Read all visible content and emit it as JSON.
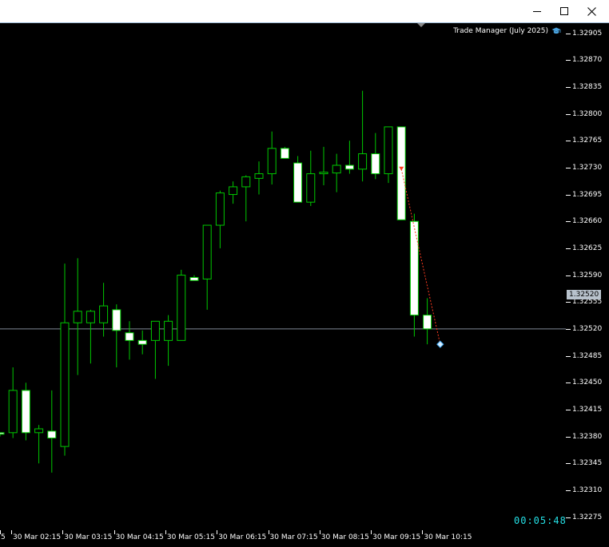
{
  "window": {
    "controls": [
      "minimize-icon",
      "maximize-icon",
      "close-icon"
    ]
  },
  "indicator": {
    "label": "Trade Manager (July 2025)",
    "icon": "graduation-cap-icon"
  },
  "countdown": "00:05:48",
  "colors": {
    "background": "#000000",
    "bull_body": "#000000",
    "bear_body": "#ffffff",
    "wick": "#00c800",
    "bid_line": "#7f8a95",
    "countdown": "#25e0e6",
    "trade_line": "#ff3b1f"
  },
  "chart_data": {
    "type": "candlestick",
    "price_axis": {
      "range": [
        1.32258,
        1.32918
      ],
      "ticks": [
        "1.32905",
        "1.32870",
        "1.32835",
        "1.32800",
        "1.32765",
        "1.32730",
        "1.32695",
        "1.32660",
        "1.32625",
        "1.32590",
        "1.32555",
        "1.32520",
        "1.32485",
        "1.32450",
        "1.32415",
        "1.32380",
        "1.32345",
        "1.32310",
        "1.32275"
      ],
      "current_price": "1.32520"
    },
    "time_axis": {
      "labels": [
        "5",
        "30 Mar 02:15",
        "30 Mar 03:15",
        "30 Mar 04:15",
        "30 Mar 05:15",
        "30 Mar 06:15",
        "30 Mar 07:15",
        "30 Mar 08:15",
        "30 Mar 09:15",
        "30 Mar 10:15"
      ]
    },
    "candles": [
      {
        "o": 1.32385,
        "h": 1.32385,
        "l": 1.3238,
        "c": 1.32383
      },
      {
        "o": 1.32385,
        "h": 1.3247,
        "l": 1.32378,
        "c": 1.3244
      },
      {
        "o": 1.3244,
        "h": 1.3245,
        "l": 1.32375,
        "c": 1.32385
      },
      {
        "o": 1.32385,
        "h": 1.32395,
        "l": 1.32345,
        "c": 1.3239
      },
      {
        "o": 1.32387,
        "h": 1.3244,
        "l": 1.32333,
        "c": 1.32378
      },
      {
        "o": 1.32367,
        "h": 1.32605,
        "l": 1.32355,
        "c": 1.32528
      },
      {
        "o": 1.32528,
        "h": 1.32612,
        "l": 1.3246,
        "c": 1.32543
      },
      {
        "o": 1.32528,
        "h": 1.32545,
        "l": 1.32475,
        "c": 1.32543
      },
      {
        "o": 1.32528,
        "h": 1.3258,
        "l": 1.3251,
        "c": 1.3255
      },
      {
        "o": 1.32545,
        "h": 1.32552,
        "l": 1.3247,
        "c": 1.32518
      },
      {
        "o": 1.32515,
        "h": 1.3253,
        "l": 1.3248,
        "c": 1.32505
      },
      {
        "o": 1.32505,
        "h": 1.32518,
        "l": 1.32487,
        "c": 1.325
      },
      {
        "o": 1.32505,
        "h": 1.3253,
        "l": 1.32455,
        "c": 1.3253
      },
      {
        "o": 1.32505,
        "h": 1.32538,
        "l": 1.32472,
        "c": 1.3253
      },
      {
        "o": 1.32505,
        "h": 1.32597,
        "l": 1.32505,
        "c": 1.3259
      },
      {
        "o": 1.32587,
        "h": 1.3259,
        "l": 1.32583,
        "c": 1.32583
      },
      {
        "o": 1.32585,
        "h": 1.3263,
        "l": 1.32545,
        "c": 1.32655
      },
      {
        "o": 1.32655,
        "h": 1.327,
        "l": 1.32625,
        "c": 1.32697
      },
      {
        "o": 1.32695,
        "h": 1.32712,
        "l": 1.32683,
        "c": 1.32705
      },
      {
        "o": 1.32705,
        "h": 1.3272,
        "l": 1.3266,
        "c": 1.32718
      },
      {
        "o": 1.32716,
        "h": 1.32738,
        "l": 1.32695,
        "c": 1.32722
      },
      {
        "o": 1.32722,
        "h": 1.32777,
        "l": 1.32708,
        "c": 1.32755
      },
      {
        "o": 1.32755,
        "h": 1.32757,
        "l": 1.32742,
        "c": 1.32742
      },
      {
        "o": 1.32736,
        "h": 1.32745,
        "l": 1.32685,
        "c": 1.32685
      },
      {
        "o": 1.32685,
        "h": 1.32752,
        "l": 1.3268,
        "c": 1.32722
      },
      {
        "o": 1.32722,
        "h": 1.32757,
        "l": 1.32707,
        "c": 1.32724
      },
      {
        "o": 1.32723,
        "h": 1.32748,
        "l": 1.32698,
        "c": 1.32733
      },
      {
        "o": 1.32733,
        "h": 1.32765,
        "l": 1.32722,
        "c": 1.32728
      },
      {
        "o": 1.32728,
        "h": 1.3283,
        "l": 1.32712,
        "c": 1.32748
      },
      {
        "o": 1.32748,
        "h": 1.32775,
        "l": 1.32715,
        "c": 1.32722
      },
      {
        "o": 1.32722,
        "h": 1.32783,
        "l": 1.3271,
        "c": 1.32783
      },
      {
        "o": 1.32783,
        "h": 1.32783,
        "l": 1.32662,
        "c": 1.32662
      },
      {
        "o": 1.3266,
        "h": 1.3267,
        "l": 1.3251,
        "c": 1.32538
      },
      {
        "o": 1.32538,
        "h": 1.3256,
        "l": 1.325,
        "c": 1.3252
      }
    ],
    "trade": {
      "entry_index": 31,
      "entry_price": 1.32728,
      "exit_index": 34,
      "exit_price": 1.325
    }
  }
}
